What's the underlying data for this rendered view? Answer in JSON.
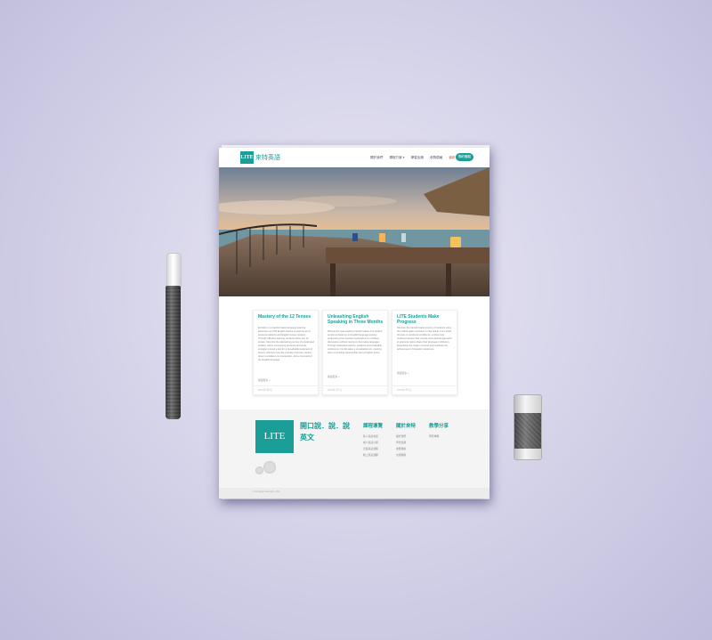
{
  "header": {
    "logo": "LITE",
    "brand": "來特英語",
    "nav": [
      "關於我們",
      "課程方案 ▾",
      "學習反饋",
      "收費價格",
      "最新消息"
    ],
    "cta": "預約體驗"
  },
  "cards": [
    {
      "title": "Mastery of the 12 Tenses",
      "body": "Embark on a transformative language learning adventure as LITE English School unveils the art of sentence patterns and English tenses mastery. Through effective learning, students delve into 12 tenses. Step into the captivating journey of a dedicated student, where overcoming sentence and tense struggles proved a test for a remarkable testament of fluency. Discover how the curiosity of tenses, tenses draw to confident communication, and a command of the English language.",
      "more": "閱讀更多 »",
      "date": "2023年7月3日"
    },
    {
      "title": "Unleashing English Speaking in Three Months",
      "body": "Witness the awe-inspiring transformation of a student as she embarks on an English language journey, progressing from hesitant expressions to confident discussions without relying on her native language. Through dedicated practice, guidance and invaluable conference, her life takes a remarkable turn, opening doors to exciting opportunities and a brighter future.",
      "more": "閱讀更多 »",
      "date": "2023年7月3日"
    },
    {
      "title": "LITE Students Make Progress",
      "body": "Discover the transformative journey of students using the LITE English curriculum in this article. From initial shyness to newfound confidence, explore how students harness their sounds and practical approach to grammar topics shape their language proficiency. Experience the magic moments and celebrate the achievement of linguistic milestones.",
      "more": "閱讀更多 »",
      "date": "2023年7月3日"
    }
  ],
  "footer": {
    "logo": "LITE",
    "slogan": "開口說．說．說英文",
    "columns": [
      {
        "heading": "課程導覽",
        "items": [
          "私人英語會話",
          "成人英語小組",
          "企業英語課程",
          "線上英語課程"
        ]
      },
      {
        "heading": "關於來特",
        "items": [
          "關於我們",
          "學習反饋",
          "收費價格",
          "交通路線"
        ]
      },
      {
        "heading": "教學分享",
        "items": [
          "學習專欄"
        ]
      }
    ],
    "copyright": "© All rights reserved. LITE"
  },
  "colors": {
    "accent": "#1a9e97",
    "nav_highlight": "#e05a3a",
    "background": "#d7d5ea"
  }
}
